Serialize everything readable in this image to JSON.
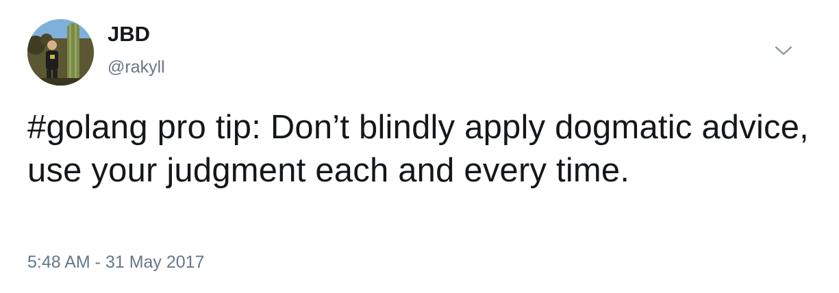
{
  "tweet": {
    "author": {
      "display_name": "JBD",
      "handle": "@rakyll"
    },
    "menu_icon": "chevron-down-icon",
    "avatar_icon": "user-avatar",
    "text": "#golang pro tip: Don’t blindly apply dogmatic advice, use your judgment each and every time.",
    "timestamp": "5:48 AM - 31 May 2017"
  },
  "colors": {
    "text_primary": "#14171a",
    "text_secondary": "#657786",
    "background": "#ffffff"
  }
}
